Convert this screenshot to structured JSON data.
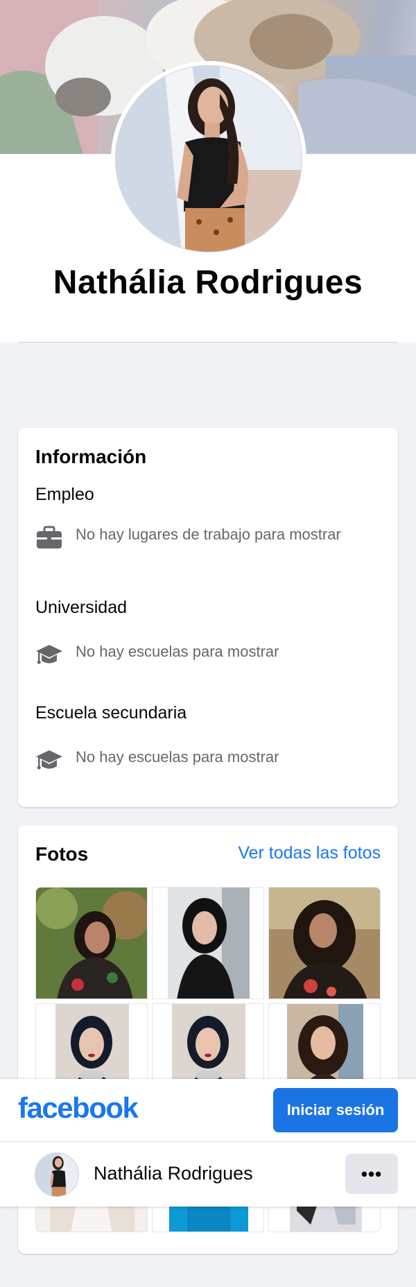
{
  "profile": {
    "name": "Nathália Rodrigues"
  },
  "info_card": {
    "title": "Información",
    "sections": [
      {
        "label": "Empleo",
        "icon": "briefcase-icon",
        "text": "No hay lugares de trabajo para mostrar"
      },
      {
        "label": "Universidad",
        "icon": "graduation-cap-icon",
        "text": "No hay escuelas para mostrar"
      },
      {
        "label": "Escuela secundaria",
        "icon": "graduation-cap-icon",
        "text": "No hay escuelas para mostrar"
      }
    ]
  },
  "photos_card": {
    "title": "Fotos",
    "see_all": "Ver todas las fotos"
  },
  "bottom_bar": {
    "logo": "facebook",
    "login_label": "Iniciar sesión",
    "profile_name": "Nathália Rodrigues",
    "more_label": "•••"
  },
  "colors": {
    "brand": "#1877f2",
    "page_bg": "#f0f2f5",
    "muted_text": "#65676b",
    "button_bg": "#1b74e4"
  }
}
